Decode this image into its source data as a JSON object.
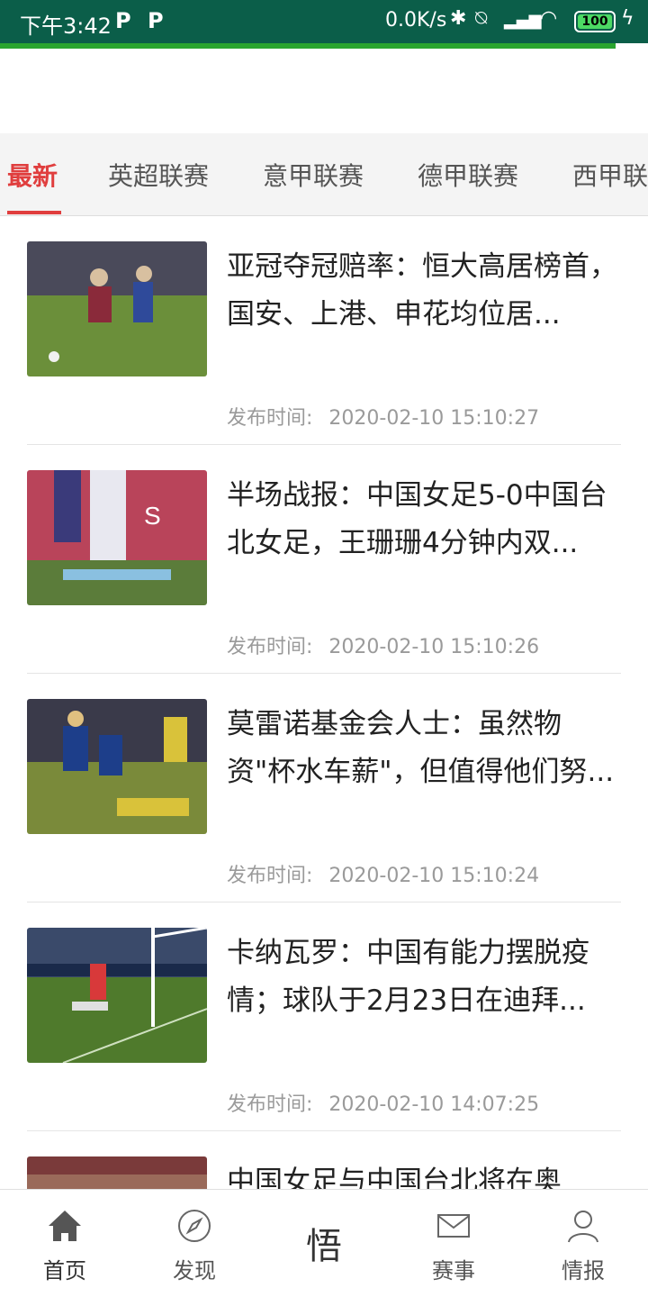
{
  "status_bar": {
    "time": "下午3:42",
    "speed": "0.0K/s",
    "battery": "100"
  },
  "page_progress": 0.95,
  "tabs": [
    {
      "label": "最新",
      "active": true
    },
    {
      "label": "英超联赛",
      "active": false
    },
    {
      "label": "意甲联赛",
      "active": false
    },
    {
      "label": "德甲联赛",
      "active": false
    },
    {
      "label": "西甲联赛",
      "active": false
    }
  ],
  "publish_label": "发布时间:",
  "articles": [
    {
      "title": "亚冠夺冠赔率：恒大高居榜首，国安、上港、申花均位居...",
      "time": "2020-02-10 15:10:27",
      "thumb_colors": [
        "#2f5a2a",
        "#6b8f3a",
        "#8a2a3a"
      ]
    },
    {
      "title": "半场战报：中国女足5-0中国台北女足，王珊珊4分钟内双...",
      "time": "2020-02-10 15:10:26",
      "thumb_colors": [
        "#b9445a",
        "#5b7c3a",
        "#e8e8f0"
      ]
    },
    {
      "title": "莫雷诺基金会人士：虽然物资\"杯水车薪\"，但值得他们努...",
      "time": "2020-02-10 15:10:24",
      "thumb_colors": [
        "#1d3e8a",
        "#7a8a3a",
        "#d9c23a"
      ]
    },
    {
      "title": "卡纳瓦罗：中国有能力摆脱疫情；球队于2月23日在迪拜...",
      "time": "2020-02-10 14:07:25",
      "thumb_colors": [
        "#2a5a8a",
        "#4f7a2c",
        "#d8393a"
      ]
    },
    {
      "title": "中国女足与中国台北将在奥",
      "time": "",
      "thumb_colors": [
        "#7a3a3a",
        "#9a6a5a",
        "#4a3a3a"
      ]
    }
  ],
  "bottom_nav": [
    {
      "label": "首页",
      "icon": "home-icon"
    },
    {
      "label": "发现",
      "icon": "compass-icon"
    },
    {
      "label": "悟",
      "icon": "center-glyph"
    },
    {
      "label": "赛事",
      "icon": "mail-icon"
    },
    {
      "label": "情报",
      "icon": "person-icon"
    }
  ]
}
